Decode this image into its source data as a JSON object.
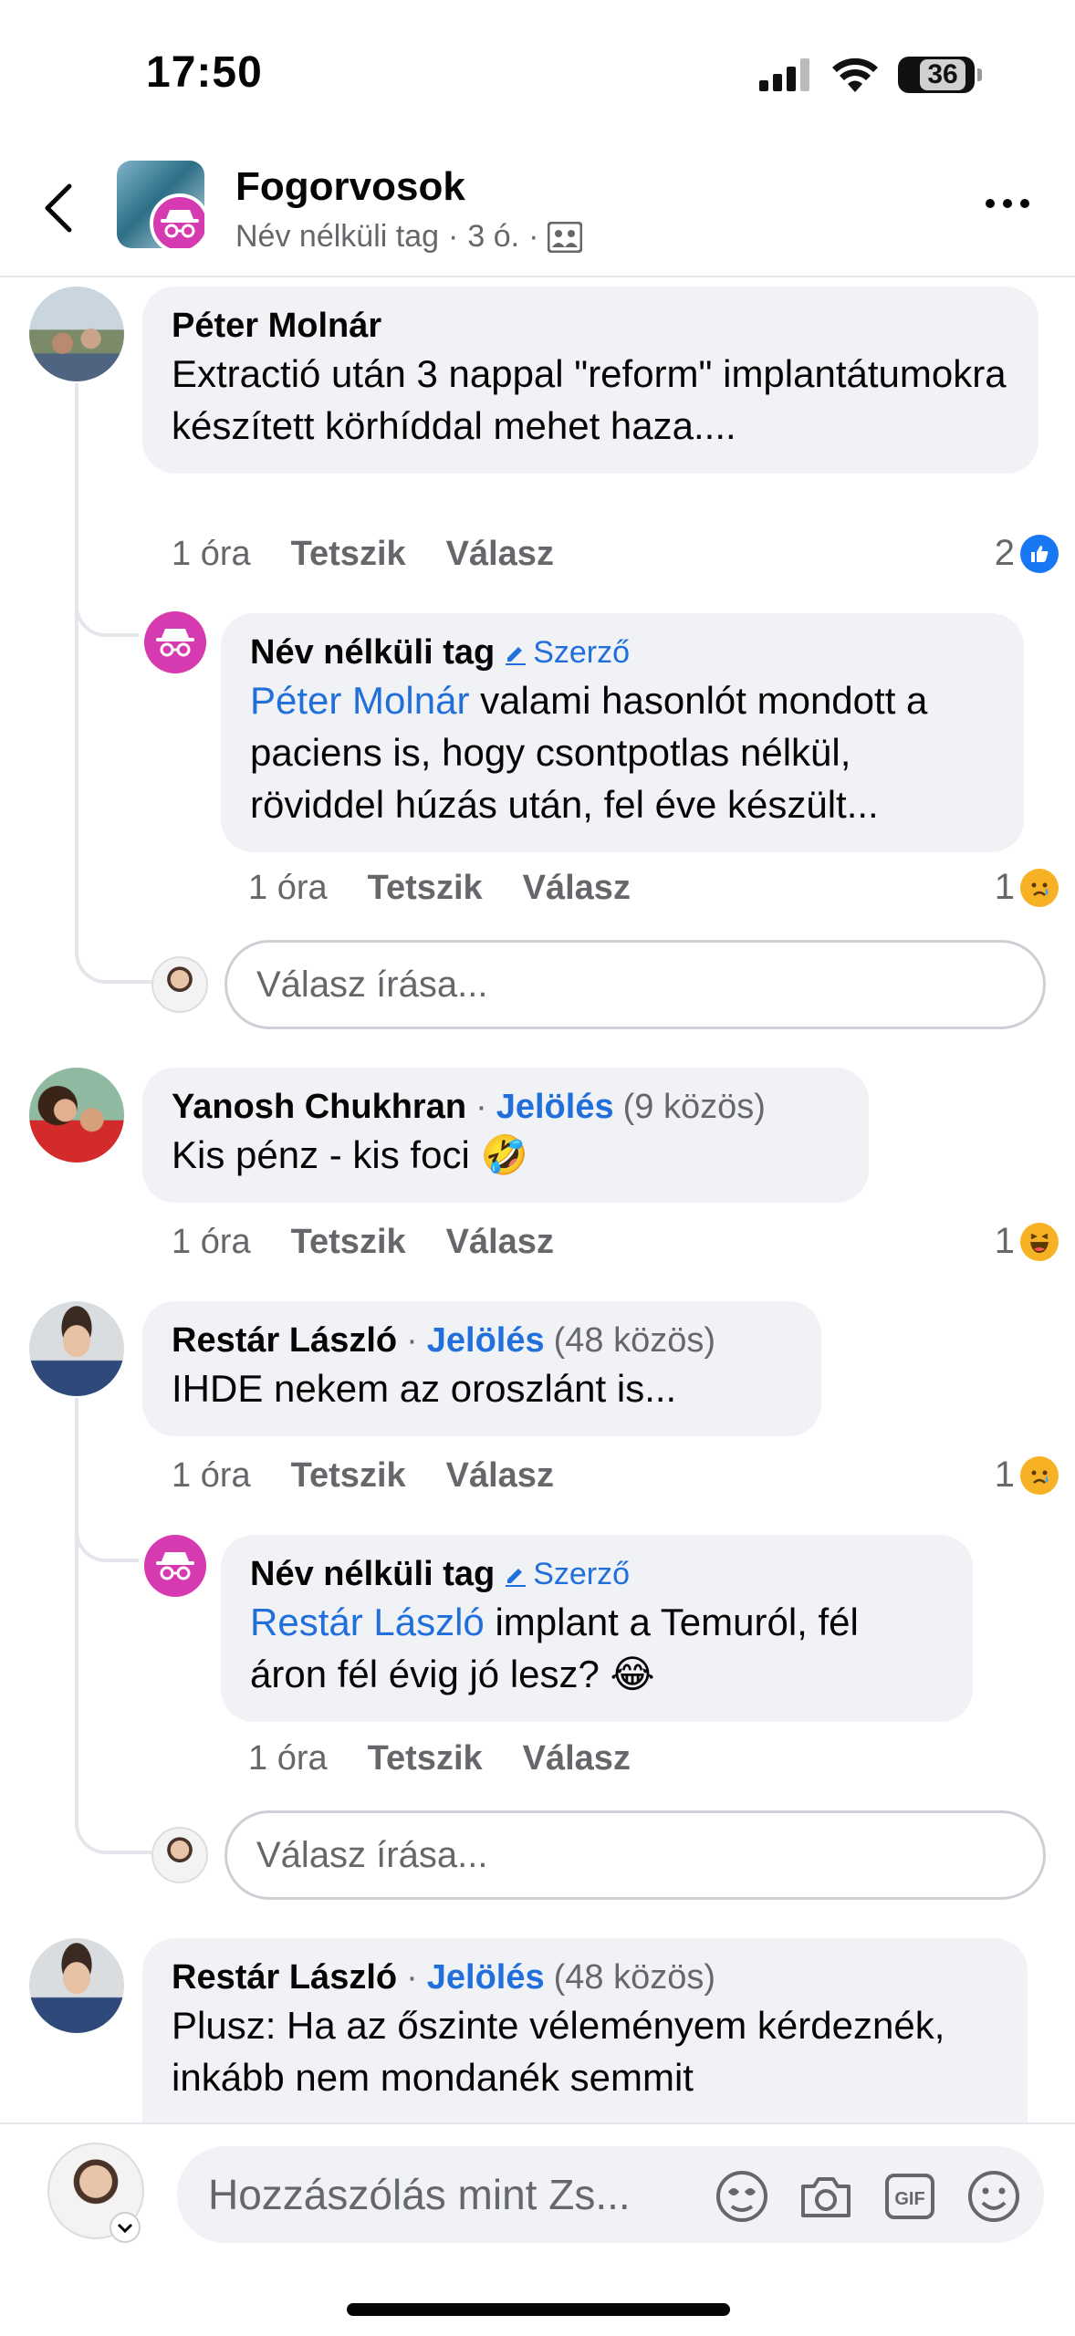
{
  "status": {
    "time": "17:50",
    "battery": "36"
  },
  "header": {
    "title": "Fogorvosok",
    "author": "Név nélküli tag",
    "sep": "·",
    "time": "3 ó.",
    "sep2": "·"
  },
  "comments": [
    {
      "name": "Péter Molnár",
      "text": "Extractió után 3 nappal \"reform\" implantátumokra készített körhíddal mehet haza....",
      "time": "1 óra",
      "like": "Tetszik",
      "reply": "Válasz",
      "reaction_count": "2",
      "reaction_icon": "like-icon",
      "replies": [
        {
          "name": "Név nélküli tag",
          "badge": "Szerző",
          "mention": "Péter Molnár",
          "text": " valami hasonlót mondott a paciens is, hogy csontpotlas nélkül, röviddel húzás után, fel éve készült...",
          "time": "1 óra",
          "like": "Tetszik",
          "reply": "Válasz",
          "reaction_count": "1",
          "reaction_icon": "sad-icon"
        }
      ],
      "reply_placeholder": "Válasz írása..."
    },
    {
      "name": "Yanosh Chukhran",
      "sep": "·",
      "tag": "Jelölés",
      "mutual": "(9 közös)",
      "text": "Kis pénz - kis foci 🤣",
      "time": "1 óra",
      "like": "Tetszik",
      "reply": "Válasz",
      "reaction_count": "1",
      "reaction_icon": "haha-icon"
    },
    {
      "name": "Restár László",
      "sep": "·",
      "tag": "Jelölés",
      "mutual": "(48 közös)",
      "text": "IHDE nekem az oroszlánt is...",
      "time": "1 óra",
      "like": "Tetszik",
      "reply": "Válasz",
      "reaction_count": "1",
      "reaction_icon": "sad-icon",
      "replies": [
        {
          "name": "Név nélküli tag",
          "badge": "Szerző",
          "mention": "Restár László",
          "text": " implant a Temuról, fél áron fél évig jó lesz? 😂",
          "time": "1 óra",
          "like": "Tetszik",
          "reply": "Válasz"
        }
      ],
      "reply_placeholder": "Válasz írása..."
    },
    {
      "name": "Restár László",
      "sep": "·",
      "tag": "Jelölés",
      "mutual": "(48 közös)",
      "text": "Plusz: Ha az őszinte véleményem kérdeznék, inkább nem mondanék semmit"
    }
  ],
  "composer": {
    "placeholder": "Hozzászólás mint Zs..."
  },
  "colors": {
    "link": "#216fdb",
    "bubble": "#f0f2f5",
    "anon": "#d63ab1",
    "secondary": "#65676b"
  }
}
